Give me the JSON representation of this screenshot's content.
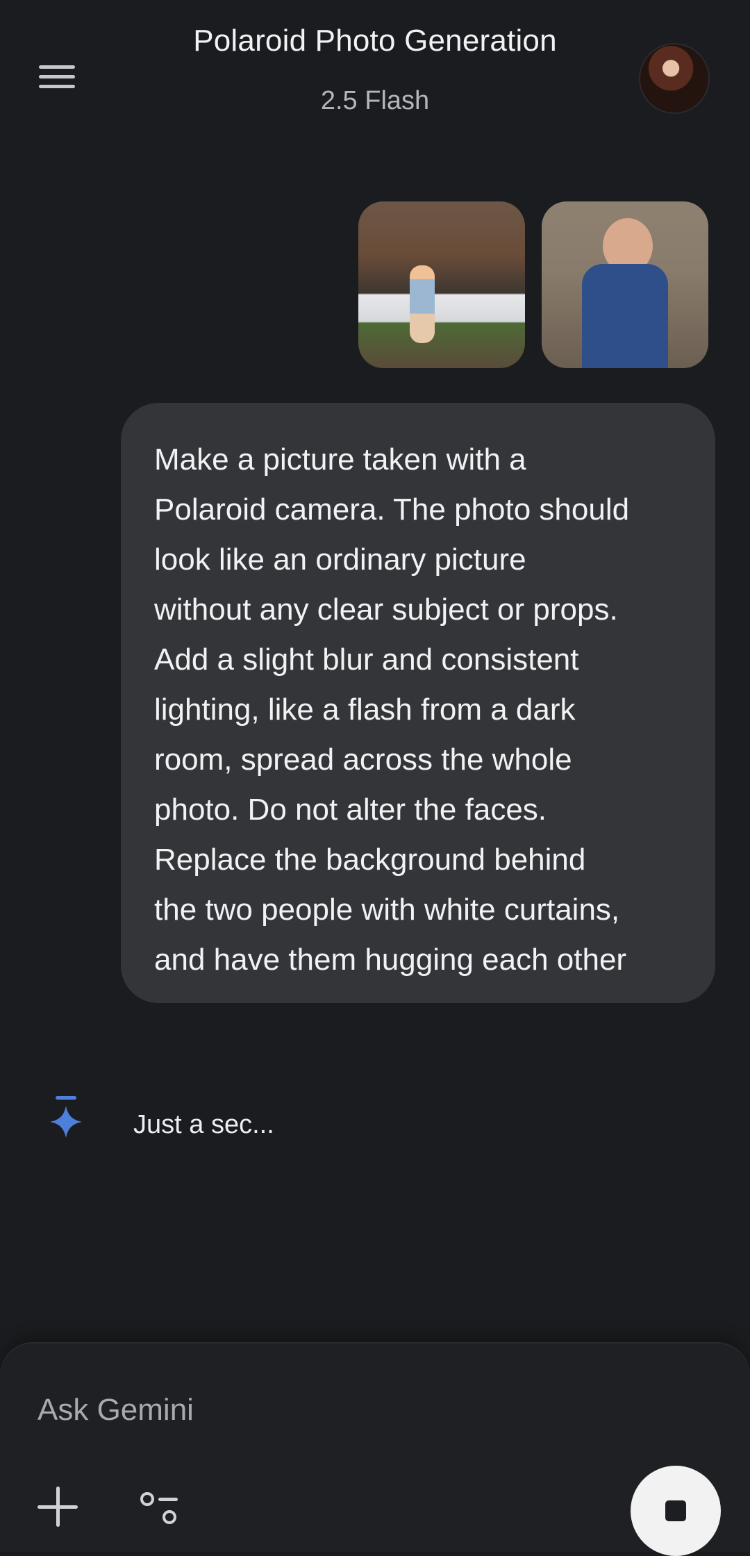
{
  "header": {
    "title": "Polaroid Photo Generation",
    "model": "2.5 Flash"
  },
  "icons": {
    "menu": "menu-icon",
    "avatar": "user-avatar",
    "spark": "gemini-spark-icon",
    "plus": "plus-icon",
    "tools": "tools-icon",
    "stop": "stop-icon"
  },
  "attachments": [
    {
      "label": "image-attachment-1"
    },
    {
      "label": "image-attachment-2"
    }
  ],
  "message": {
    "text": "Make a picture taken with a\nPolaroid camera. The photo should\nlook like an ordinary picture\nwithout any clear subject or props.\nAdd a slight blur and consistent\nlighting, like a flash from a dark\nroom, spread across the whole\nphoto. Do not alter the faces.\nReplace the background behind\nthe two people with white curtains,\nand have them hugging each other"
  },
  "assistant": {
    "status": "Just a sec..."
  },
  "composer": {
    "placeholder": "Ask Gemini"
  },
  "colors": {
    "background": "#1b1c1f",
    "bubble": "#333538",
    "accent": "#4f7fdc"
  }
}
